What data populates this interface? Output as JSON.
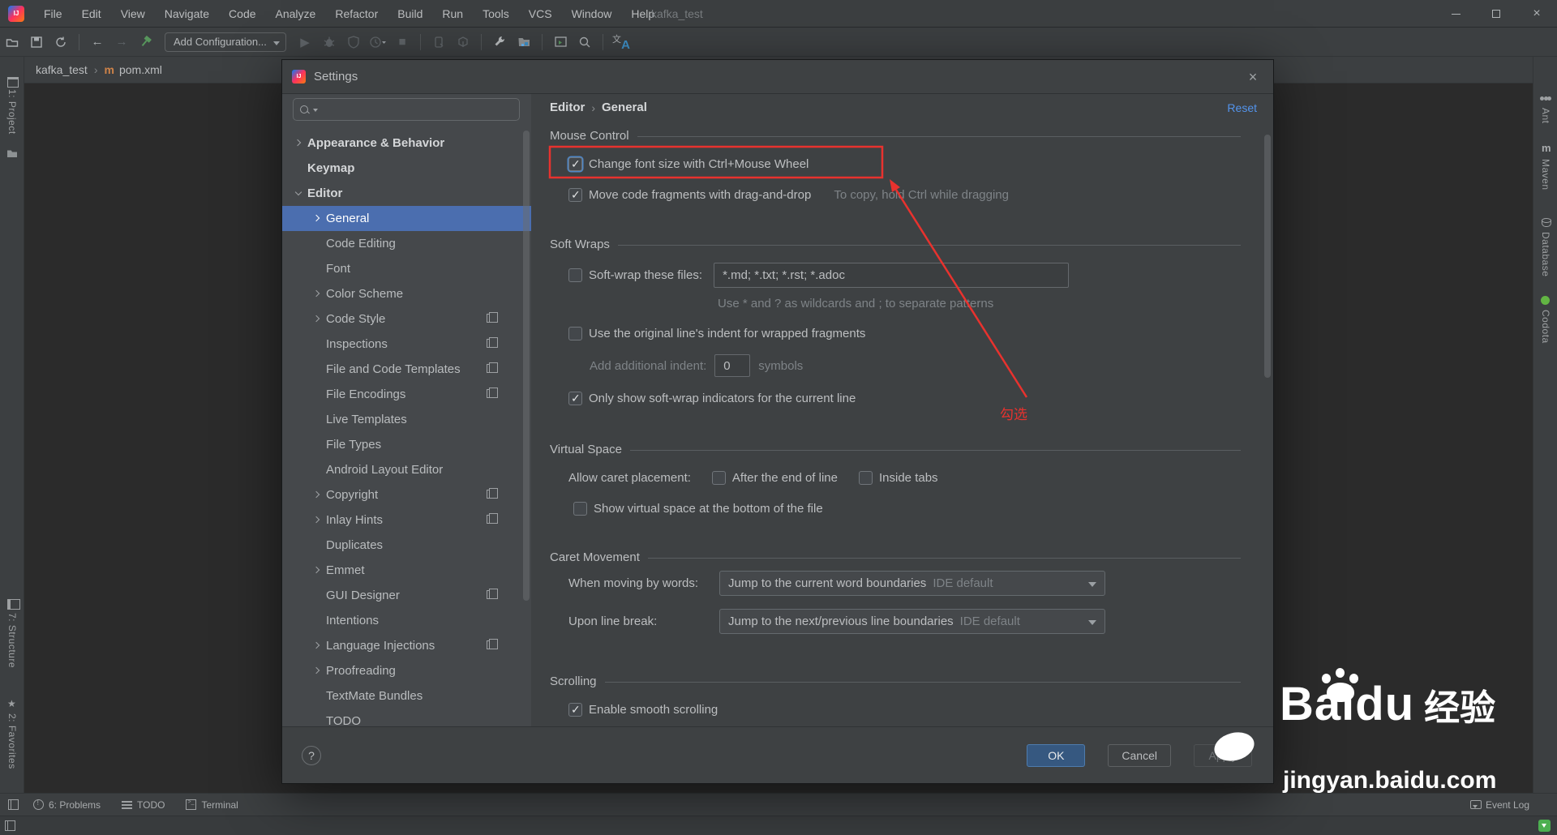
{
  "colors": {
    "accent_selection": "#4B6EAF",
    "ok_button_blue": "#365880",
    "reset_link_blue": "#5394EC",
    "annotation_red": "#E8322E",
    "codota_green": "#62B543",
    "hammer_green": "#57965C",
    "translate_blue": "#3E8FC6",
    "maven_orange": "#CE8349"
  },
  "menubar": {
    "items": [
      "File",
      "Edit",
      "View",
      "Navigate",
      "Code",
      "Analyze",
      "Refactor",
      "Build",
      "Run",
      "Tools",
      "VCS",
      "Window",
      "Help"
    ],
    "window_title": "kafka_test"
  },
  "toolbar": {
    "add_configuration": "Add Configuration..."
  },
  "breadcrumb": {
    "project": "kafka_test",
    "file": "pom.xml"
  },
  "left_stripe": {
    "items": [
      {
        "label": "1: Project",
        "icon": "project"
      },
      {
        "label": "7: Structure",
        "icon": "structure"
      },
      {
        "label": "2: Favorites",
        "icon": "favorites"
      }
    ]
  },
  "right_stripe": {
    "items": [
      {
        "label": "Ant",
        "icon": "ant"
      },
      {
        "label": "Maven",
        "icon": "maven"
      },
      {
        "label": "Database",
        "icon": "database"
      },
      {
        "label": "Codota",
        "icon": "codota"
      }
    ]
  },
  "bottom_bar": {
    "problems": "6: Problems",
    "todo": "TODO",
    "terminal": "Terminal",
    "event_log": "Event Log"
  },
  "dialog": {
    "title": "Settings",
    "tree": [
      {
        "label": "Appearance & Behavior",
        "level": 1,
        "chevron": "right",
        "bold": true
      },
      {
        "label": "Keymap",
        "level": 1,
        "bold": true
      },
      {
        "label": "Editor",
        "level": 1,
        "chevron": "down",
        "bold": true
      },
      {
        "label": "General",
        "level": 2,
        "chevron": "right",
        "selected": true
      },
      {
        "label": "Code Editing",
        "level": 2
      },
      {
        "label": "Font",
        "level": 2
      },
      {
        "label": "Color Scheme",
        "level": 2,
        "chevron": "right"
      },
      {
        "label": "Code Style",
        "level": 2,
        "chevron": "right",
        "copy": true
      },
      {
        "label": "Inspections",
        "level": 2,
        "copy": true
      },
      {
        "label": "File and Code Templates",
        "level": 2,
        "copy": true
      },
      {
        "label": "File Encodings",
        "level": 2,
        "copy": true
      },
      {
        "label": "Live Templates",
        "level": 2
      },
      {
        "label": "File Types",
        "level": 2
      },
      {
        "label": "Android Layout Editor",
        "level": 2
      },
      {
        "label": "Copyright",
        "level": 2,
        "chevron": "right",
        "copy": true
      },
      {
        "label": "Inlay Hints",
        "level": 2,
        "chevron": "right",
        "copy": true
      },
      {
        "label": "Duplicates",
        "level": 2
      },
      {
        "label": "Emmet",
        "level": 2,
        "chevron": "right"
      },
      {
        "label": "GUI Designer",
        "level": 2,
        "copy": true
      },
      {
        "label": "Intentions",
        "level": 2
      },
      {
        "label": "Language Injections",
        "level": 2,
        "chevron": "right",
        "copy": true
      },
      {
        "label": "Proofreading",
        "level": 2,
        "chevron": "right"
      },
      {
        "label": "TextMate Bundles",
        "level": 2
      },
      {
        "label": "TODO",
        "level": 2
      }
    ],
    "header": {
      "section": "Editor",
      "sep": "›",
      "page": "General",
      "reset": "Reset"
    },
    "sections": {
      "mouse": {
        "title": "Mouse Control",
        "cb_font": {
          "label": "Change font size with Ctrl+Mouse Wheel",
          "checked": true
        },
        "cb_drag": {
          "label": "Move code fragments with drag-and-drop",
          "checked": true,
          "hint": "To copy, hold Ctrl while dragging"
        }
      },
      "soft_wraps": {
        "title": "Soft Wraps",
        "cb_files": {
          "label": "Soft-wrap these files:",
          "checked": false
        },
        "files_value": "*.md; *.txt; *.rst; *.adoc",
        "wildcards_hint": "Use * and ? as wildcards and ; to separate patterns",
        "cb_indent": {
          "label": "Use the original line's indent for wrapped fragments",
          "checked": false
        },
        "add_indent_label": "Add additional indent:",
        "add_indent_value": "0",
        "add_indent_suffix": "symbols",
        "cb_indicators": {
          "label": "Only show soft-wrap indicators for the current line",
          "checked": true
        }
      },
      "virtual_space": {
        "title": "Virtual Space",
        "allow_label": "Allow caret placement:",
        "cb_after": {
          "label": "After the end of line",
          "checked": false
        },
        "cb_inside": {
          "label": "Inside tabs",
          "checked": false
        },
        "cb_bottom": {
          "label": "Show virtual space at the bottom of the file",
          "checked": false
        }
      },
      "caret": {
        "title": "Caret Movement",
        "words_label": "When moving by words:",
        "words_value": "Jump to the current word boundaries",
        "words_badge": "IDE default",
        "break_label": "Upon line break:",
        "break_value": "Jump to the next/previous line boundaries",
        "break_badge": "IDE default"
      },
      "scrolling": {
        "title": "Scrolling",
        "cb_smooth": {
          "label": "Enable smooth scrolling",
          "checked": true
        }
      }
    },
    "footer": {
      "help": "?",
      "ok": "OK",
      "cancel": "Cancel",
      "apply": "Apply"
    }
  },
  "annotation": {
    "label": "勾选"
  },
  "watermark": {
    "bai": "Bai",
    "du": "du",
    "cn": "经验",
    "url": "jingyan.baidu.com"
  }
}
